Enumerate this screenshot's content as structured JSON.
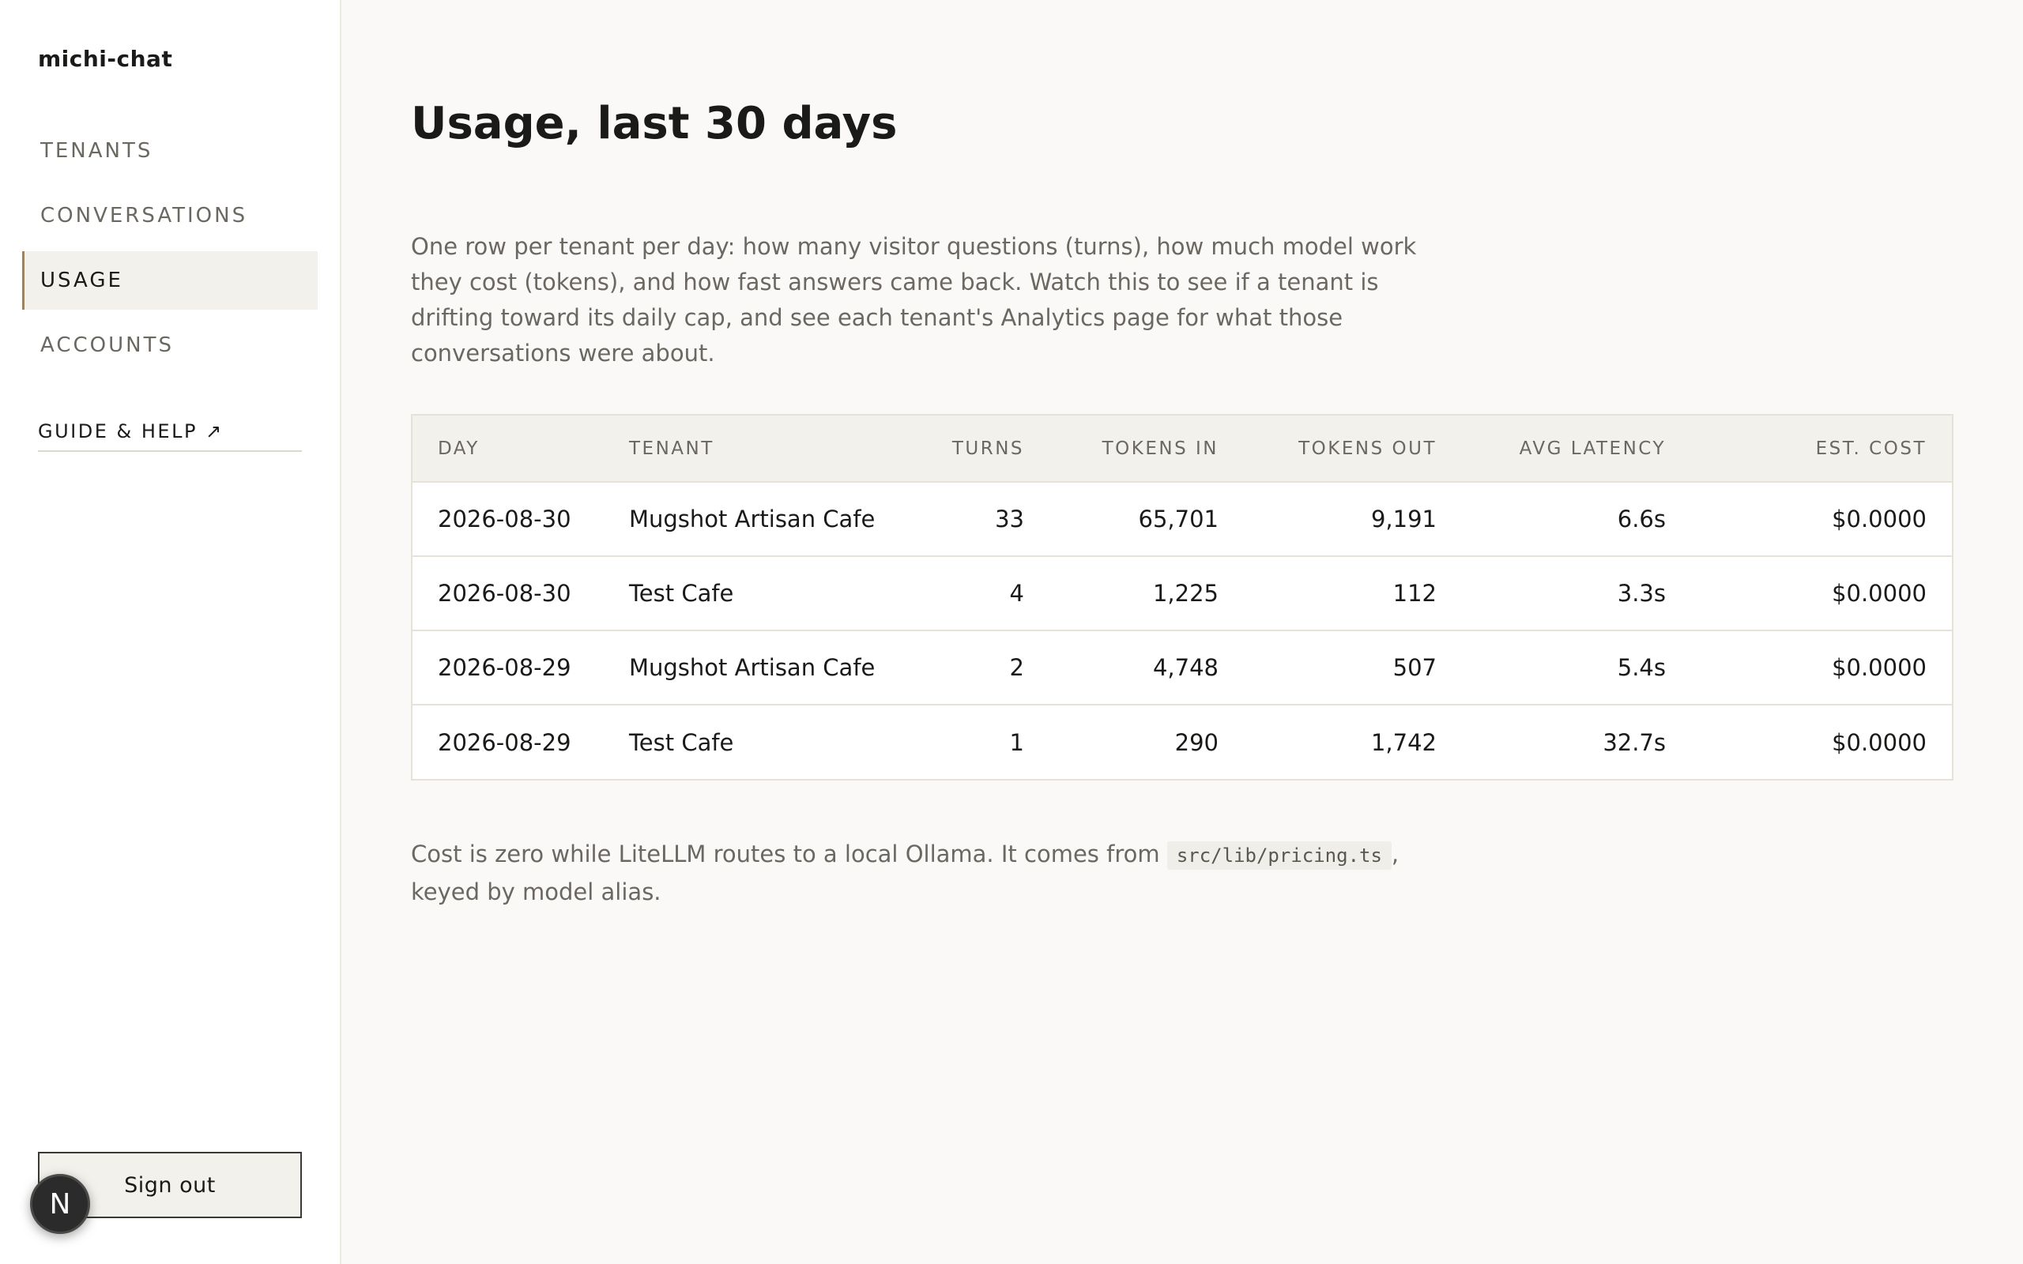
{
  "app": {
    "brand": "michi-chat"
  },
  "sidebar": {
    "items": [
      {
        "label": "TENANTS",
        "active": false
      },
      {
        "label": "CONVERSATIONS",
        "active": false
      },
      {
        "label": "USAGE",
        "active": true
      },
      {
        "label": "ACCOUNTS",
        "active": false
      }
    ],
    "guide_label": "GUIDE & HELP ↗",
    "signout_label": "Sign out",
    "badge_letter": "N"
  },
  "main": {
    "title": "Usage, last 30 days",
    "intro": "One row per tenant per day: how many visitor questions (turns), how much model work they cost (tokens), and how fast answers came back. Watch this to see if a tenant is drifting toward its daily cap, and see each tenant's Analytics page for what those conversations were about.",
    "table": {
      "headers": [
        "DAY",
        "TENANT",
        "TURNS",
        "TOKENS IN",
        "TOKENS OUT",
        "AVG LATENCY",
        "EST. COST"
      ],
      "rows": [
        [
          "2026-08-30",
          "Mugshot Artisan Cafe",
          "33",
          "65,701",
          "9,191",
          "6.6s",
          "$0.0000"
        ],
        [
          "2026-08-30",
          "Test Cafe",
          "4",
          "1,225",
          "112",
          "3.3s",
          "$0.0000"
        ],
        [
          "2026-08-29",
          "Mugshot Artisan Cafe",
          "2",
          "4,748",
          "507",
          "5.4s",
          "$0.0000"
        ],
        [
          "2026-08-29",
          "Test Cafe",
          "1",
          "290",
          "1,742",
          "32.7s",
          "$0.0000"
        ]
      ]
    },
    "footer": {
      "before": "Cost is zero while LiteLLM routes to a local Ollama. It comes from ",
      "code": "src/lib/pricing.ts",
      "after": ", keyed by model alias."
    }
  }
}
